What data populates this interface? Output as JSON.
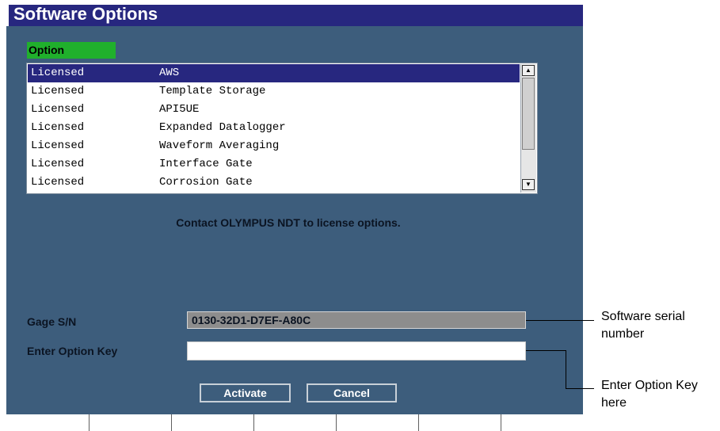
{
  "title": "Software Options",
  "list": {
    "column_header": "Option",
    "rows": [
      {
        "status": "Licensed",
        "name": "AWS"
      },
      {
        "status": "Licensed",
        "name": "Template Storage"
      },
      {
        "status": "Licensed",
        "name": "API5UE"
      },
      {
        "status": "Licensed",
        "name": "Expanded Datalogger"
      },
      {
        "status": "Licensed",
        "name": "Waveform Averaging"
      },
      {
        "status": "Licensed",
        "name": "Interface Gate"
      },
      {
        "status": "Licensed",
        "name": "Corrosion Gate"
      }
    ],
    "selected_index": 0,
    "scroll_up_icon": "triangle-up-icon",
    "scroll_down_icon": "triangle-down-icon"
  },
  "contact_message": "Contact OLYMPUS NDT to license options.",
  "gage_sn_label": "Gage S/N",
  "gage_sn_value": "0130-32D1-D7EF-A80C",
  "option_key_label": "Enter Option Key",
  "option_key_value": "",
  "buttons": {
    "activate": "Activate",
    "cancel": "Cancel"
  },
  "annotations": {
    "serial": "Software serial number",
    "option_key": "Enter Option Key here"
  },
  "colors": {
    "background": "#3d5d7c",
    "title_bar": "#27277f",
    "header_tab": "#20b02c",
    "selected_row": "#27277f"
  }
}
